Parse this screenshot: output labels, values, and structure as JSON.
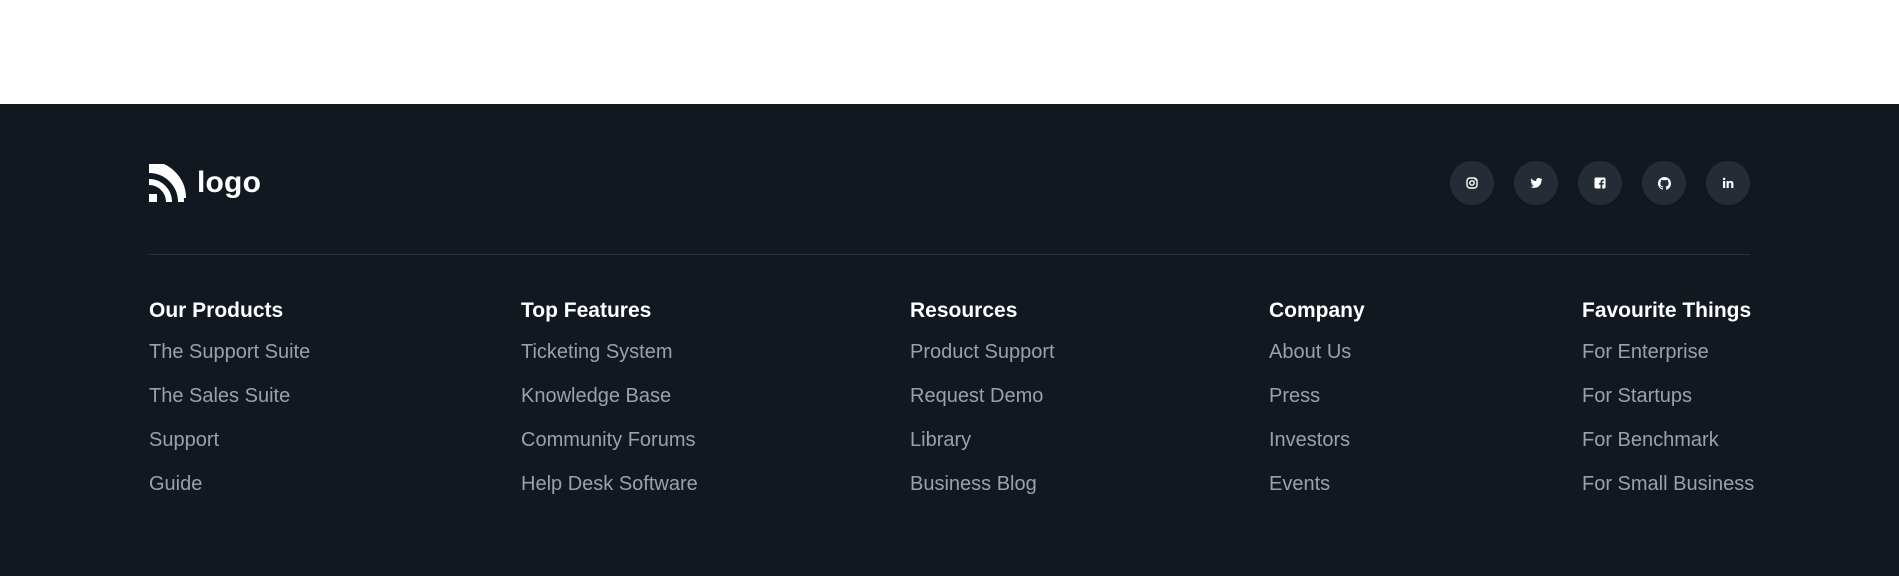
{
  "logo": {
    "text": "logo"
  },
  "social": [
    {
      "name": "instagram-icon"
    },
    {
      "name": "twitter-icon"
    },
    {
      "name": "facebook-icon"
    },
    {
      "name": "github-icon"
    },
    {
      "name": "linkedin-icon"
    }
  ],
  "columns": [
    {
      "heading": "Our Products",
      "links": [
        "The Support Suite",
        "The Sales Suite",
        "Support",
        "Guide"
      ]
    },
    {
      "heading": "Top Features",
      "links": [
        "Ticketing System",
        "Knowledge Base",
        "Community Forums",
        "Help Desk Software"
      ]
    },
    {
      "heading": "Resources",
      "links": [
        "Product Support",
        "Request Demo",
        "Library",
        "Business Blog"
      ]
    },
    {
      "heading": "Company",
      "links": [
        "About Us",
        "Press",
        "Investors",
        "Events"
      ]
    },
    {
      "heading": "Favourite Things",
      "links": [
        "For Enterprise",
        "For Startups",
        "For Benchmark",
        "For Small Business"
      ]
    }
  ],
  "colors": {
    "footer_bg": "#111820",
    "heading": "#ffffff",
    "link": "#9aa1a9",
    "social_bg": "#252c35"
  }
}
